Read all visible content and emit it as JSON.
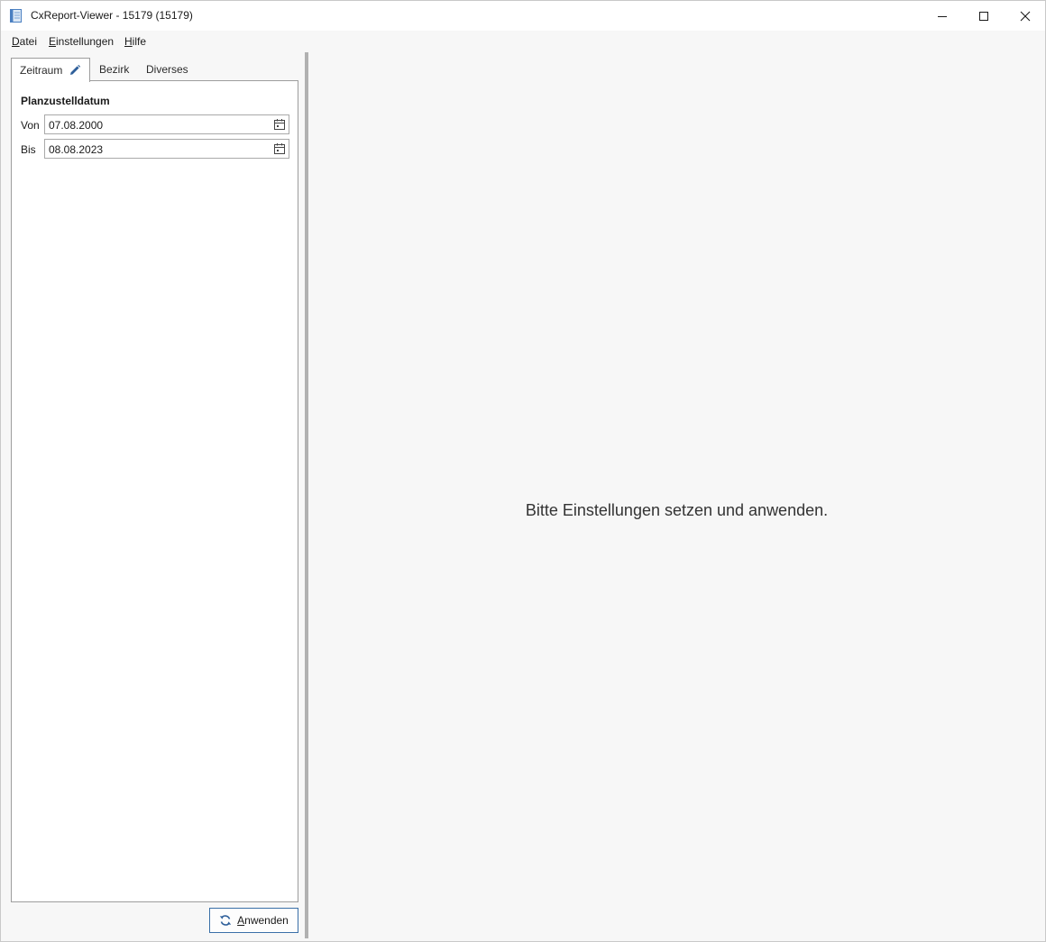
{
  "window": {
    "title": "CxReport-Viewer - 15179 (15179)",
    "accent_color": "#3a6fa8"
  },
  "menu": {
    "items": [
      {
        "accel": "D",
        "rest": "atei"
      },
      {
        "accel": "E",
        "rest": "instellungen"
      },
      {
        "accel": "H",
        "rest": "ilfe"
      }
    ]
  },
  "tabs": [
    {
      "label": "Zeitraum",
      "icon": "pencil-icon",
      "active": true
    },
    {
      "label": "Bezirk",
      "active": false
    },
    {
      "label": "Diverses",
      "active": false
    }
  ],
  "panel": {
    "section_title": "Planzustelldatum",
    "from_label": "Von",
    "from_value": "07.08.2000",
    "to_label": "Bis",
    "to_value": "08.08.2023",
    "field_icon": "calendar-icon"
  },
  "apply_button": {
    "accel": "A",
    "rest": "nwenden",
    "icon": "refresh-icon"
  },
  "main": {
    "message": "Bitte Einstellungen setzen und anwenden."
  }
}
